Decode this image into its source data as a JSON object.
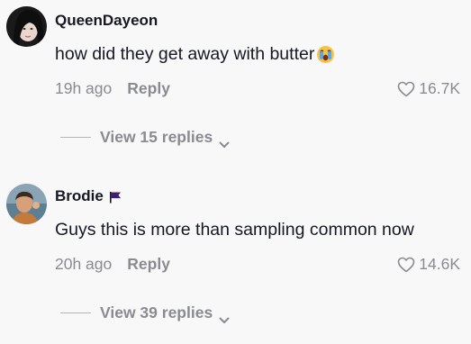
{
  "comments": [
    {
      "username": "QueenDayeon",
      "text": "how did they get away with butter",
      "emoji": "crying-face-emoji",
      "time": "19h ago",
      "reply_label": "Reply",
      "likes": "16.7K",
      "view_replies": "View 15 replies"
    },
    {
      "username": "Brodie",
      "badge": "purple-flag",
      "text": "Guys this is more than sampling common now",
      "time": "20h ago",
      "reply_label": "Reply",
      "likes": "14.6K",
      "view_replies": "View 39 replies"
    }
  ],
  "colors": {
    "background": "#f8f8f8",
    "primary_text": "#161823",
    "secondary_text": "#8a8b91",
    "flag": "#3e1f6e"
  }
}
